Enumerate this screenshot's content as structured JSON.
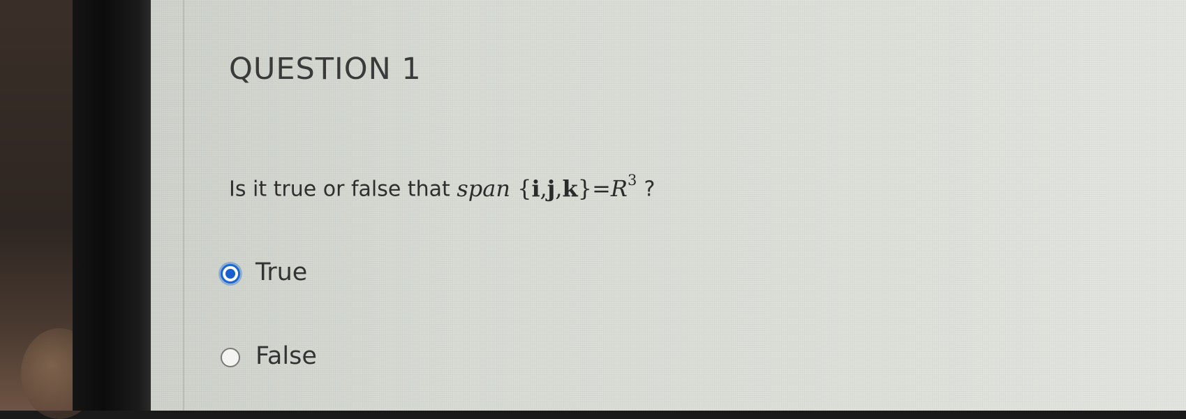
{
  "question": {
    "title": "QUESTION 1",
    "prompt_prefix": "Is it true or false that ",
    "math": {
      "func": "span",
      "open_brace": "{",
      "vectors": [
        "i",
        "j",
        "k"
      ],
      "separator": ",",
      "close_brace": "}",
      "equals": "=",
      "space": "R",
      "exponent": "3"
    },
    "prompt_suffix": "?"
  },
  "options": [
    {
      "label": "True",
      "selected": true
    },
    {
      "label": "False",
      "selected": false
    }
  ],
  "colors": {
    "radio_selected": "#1a5fd0",
    "text": "#333333"
  }
}
